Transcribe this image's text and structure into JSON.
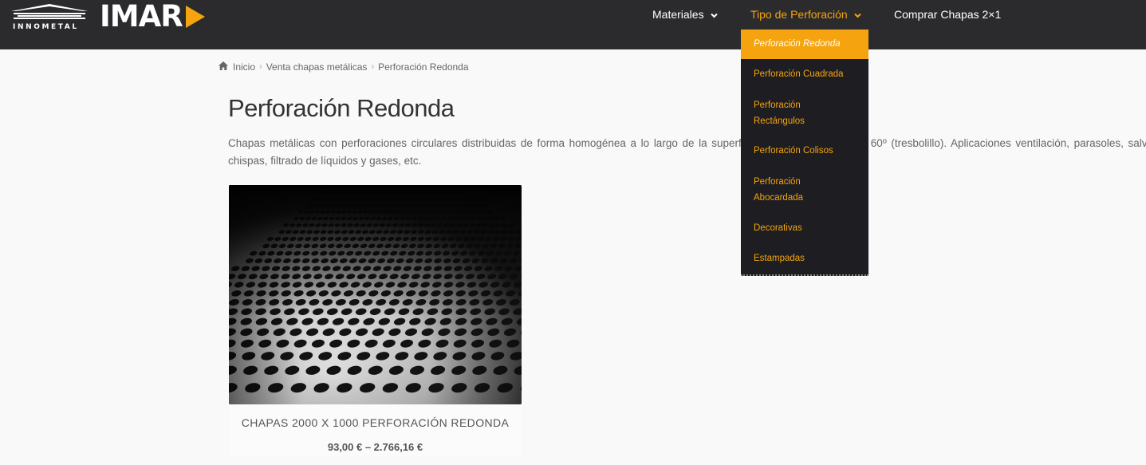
{
  "header": {
    "logo_innometal": "INNOMETAL",
    "logo_imar": "IMAR",
    "nav": [
      {
        "label": "Materiales",
        "icon": "chevron-down-icon"
      },
      {
        "label": "Tipo de Perforación",
        "icon": "chevron-down-icon",
        "active": true
      },
      {
        "label": "Comprar Chapas 2×1"
      }
    ]
  },
  "dropdown": {
    "items": [
      {
        "label": "Perforación Redonda",
        "selected": true
      },
      {
        "label": "Perforación Cuadrada"
      },
      {
        "label": "Perforación Rectángulos"
      },
      {
        "label": "Perforación Colisos"
      },
      {
        "label": "Perforación Abocardada"
      },
      {
        "label": "Decorativas"
      },
      {
        "label": "Estampadas"
      }
    ]
  },
  "breadcrumb": {
    "icon": "home-icon",
    "items": [
      "Inicio",
      "Venta chapas metálicas",
      "Perforación Redonda"
    ],
    "separator": "›"
  },
  "page": {
    "title": "Perforación Redonda",
    "description": "Chapas metálicas con perforaciones circulares distribuidas de forma homogénea a lo largo de la superficie formando ángulos de 60º (tresbolillo). Aplicaciones ventilación, parasoles, salva chispas, filtrado de líquidos y gases, etc."
  },
  "product": {
    "name": "CHAPAS 2000 X 1000 PERFORACIÓN REDONDA",
    "price": "93,00 € – 2.766,16 €"
  },
  "colors": {
    "header_bg": "#2b2b2d",
    "accent": "#f5a30e",
    "dropdown_bg": "#1e1e22",
    "page_bg": "#f9f9f9"
  }
}
